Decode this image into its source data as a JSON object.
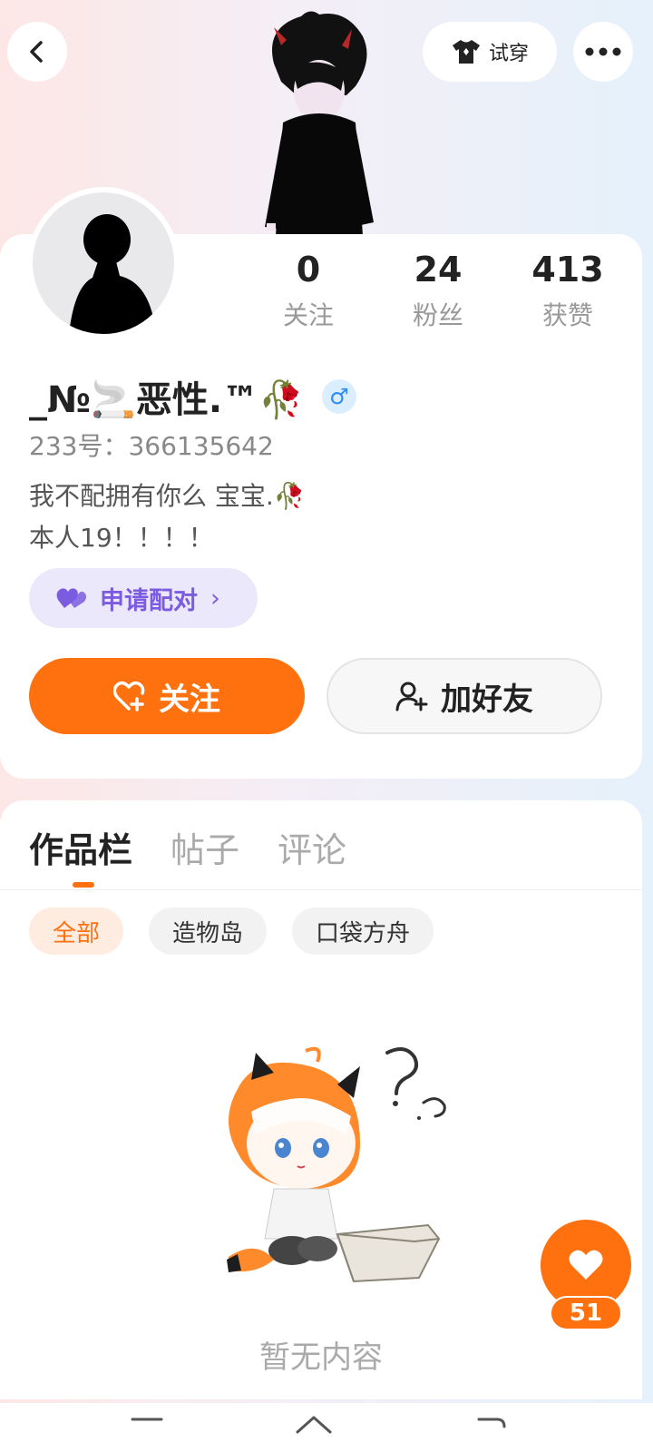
{
  "header": {
    "try_on_label": "试穿",
    "icons": {
      "back": "back-arrow-icon",
      "try_on": "tshirt-icon",
      "more": "more-dots-icon"
    }
  },
  "profile": {
    "stats": [
      {
        "value": "0",
        "label": "关注"
      },
      {
        "value": "24",
        "label": "粉丝"
      },
      {
        "value": "413",
        "label": "获赞"
      }
    ],
    "username": "_№🚬恶性.™🥀",
    "gender_icon": "male-icon",
    "uid": "233号：366135642",
    "bio_line1": "我不配拥有你么 宝宝.🥀",
    "bio_line2": "本人19！！！！",
    "pair_label": "申请配对",
    "follow_label": "关注",
    "add_friend_label": "加好友"
  },
  "tabs": [
    {
      "label": "作品栏",
      "active": true
    },
    {
      "label": "帖子",
      "active": false
    },
    {
      "label": "评论",
      "active": false
    }
  ],
  "filters": [
    {
      "label": "全部",
      "active": true
    },
    {
      "label": "造物岛",
      "active": false
    },
    {
      "label": "口袋方舟",
      "active": false
    }
  ],
  "empty_state": {
    "text": "暂无内容"
  },
  "fab": {
    "count": "51"
  },
  "colors": {
    "accent": "#ff700f",
    "pair": "#7b5ce0",
    "male": "#2d8cf0"
  }
}
